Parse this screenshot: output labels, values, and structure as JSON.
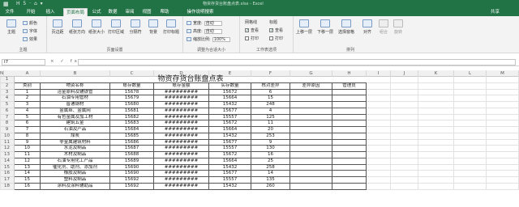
{
  "window": {
    "title": "物资存货台账盘点表.xlsx - Excel",
    "app_icon": "excel-icon",
    "qat": "H 5 · ⌂ ▾"
  },
  "tabs": [
    "文件",
    "开始",
    "插入",
    "页面布局",
    "公式",
    "数据",
    "审阅",
    "视图",
    "帮助",
    "操作说明搜索"
  ],
  "active_tab": "页面布局",
  "share_label": "共享",
  "ribbon": {
    "theme": {
      "label": "主题",
      "colors": "颜色",
      "fonts": "字体",
      "effects": "效果",
      "group": "主题"
    },
    "pagesetup": {
      "margins": "页边距",
      "orientation": "纸张方向",
      "size": "纸张大小",
      "printarea": "打印区域",
      "breaks": "分隔符",
      "background": "背景",
      "printtitles": "打印标题",
      "group": "页面设置"
    },
    "scale": {
      "width_label": "宽度:",
      "width_val": "自动",
      "height_label": "高度:",
      "height_val": "自动",
      "scale_label": "缩放比例:",
      "scale_val": "100%",
      "group": "调整为合适大小"
    },
    "sheetopts": {
      "grid": "网格线",
      "headings": "标题",
      "view1": "查看",
      "view2": "查看",
      "print1": "打印",
      "print2": "打印",
      "group": "工作表选项"
    },
    "arrange": {
      "forward": "上移一层",
      "backward": "下移一层",
      "pane": "选择窗格",
      "align": "对齐",
      "group_btn": "组合",
      "rotate": "旋转",
      "group": "排列"
    }
  },
  "formula_bar": {
    "namebox": "I7",
    "fx": "× ✓ fx",
    "value": ""
  },
  "columns": [
    "A",
    "B",
    "C",
    "D",
    "E",
    "F",
    "G",
    "H",
    "I",
    "J",
    "K",
    "L",
    "M",
    "N"
  ],
  "sheet": {
    "title": "物资存货台账盘点表",
    "headers": [
      "类别",
      "物资名称",
      "账存数量",
      "账存金额",
      "实存数量",
      "核对差异",
      "差异原因",
      "管理员"
    ],
    "rows": [
      [
        "1",
        "洽金原料及辅铁管",
        "15678",
        "#########",
        "15672",
        "6"
      ],
      [
        "2",
        "石油专用管材",
        "15679",
        "#########",
        "15664",
        "15"
      ],
      [
        "3",
        "普通钢材",
        "15680",
        "#########",
        "15432",
        "248"
      ],
      [
        "4",
        "金属丝、金属网",
        "15681",
        "#########",
        "15677",
        "4"
      ],
      [
        "5",
        "有色金属及加工材",
        "15682",
        "#########",
        "15557",
        "125"
      ],
      [
        "6",
        "建筑五金",
        "15683",
        "#########",
        "15672",
        "11"
      ],
      [
        "7",
        "石油及产品",
        "15684",
        "#########",
        "15664",
        "20"
      ],
      [
        "8",
        "煤炭",
        "15685",
        "#########",
        "15432",
        "253"
      ],
      [
        "9",
        "非金属建筑材料",
        "15686",
        "#########",
        "15677",
        "9"
      ],
      [
        "10",
        "水泥及制品",
        "15687",
        "#########",
        "15557",
        "130"
      ],
      [
        "11",
        "木材及制品",
        "15688",
        "#########",
        "15672",
        "16"
      ],
      [
        "12",
        "石油专用化工产品",
        "15689",
        "#########",
        "15664",
        "25"
      ],
      [
        "13",
        "催化剂、助剂、添加剂",
        "15690",
        "#########",
        "15432",
        "258"
      ],
      [
        "14",
        "橡胶及制品",
        "15690",
        "#########",
        "15677",
        "14"
      ],
      [
        "15",
        "塑料及制品",
        "15692",
        "#########",
        "15557",
        "135"
      ],
      [
        "16",
        "涂料及涂料辅助品",
        "15692",
        "#########",
        "15432",
        "260"
      ]
    ]
  }
}
